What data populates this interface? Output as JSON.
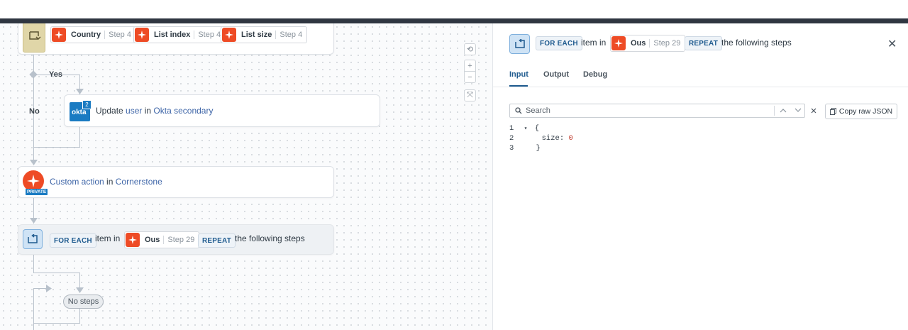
{
  "canvas": {
    "top_card": {
      "pills": [
        {
          "name": "Country",
          "step": "Step 4"
        },
        {
          "name": "List index",
          "step": "Step 4"
        },
        {
          "name": "List size",
          "step": "Step 4"
        }
      ]
    },
    "branch": {
      "yes_label": "Yes",
      "no_label": "No"
    },
    "update_step": {
      "badge_count": "2",
      "badge_text": "okta",
      "verb": "Update",
      "object": "user",
      "in": "in",
      "app": "Okta secondary"
    },
    "custom_step": {
      "verb": "Custom action",
      "in": "in",
      "app": "Cornerstone",
      "tag": "PRIVATE"
    },
    "foreach_step": {
      "keyword": "FOR EACH",
      "item_in": "item in",
      "pill_name": "Ous",
      "pill_step": "Step 29",
      "repeat": "REPEAT",
      "tail": "the following steps"
    },
    "no_steps_label": "No steps",
    "zoom": {
      "reset": "⟲",
      "in": "+",
      "out": "−",
      "fit": "⤧"
    }
  },
  "panel": {
    "header": {
      "keyword": "FOR EACH",
      "item_in": "item in",
      "pill_name": "Ous",
      "pill_step": "Step 29",
      "repeat": "REPEAT",
      "tail": "the following steps",
      "close": "✕"
    },
    "tabs": [
      {
        "label": "Input",
        "active": true
      },
      {
        "label": "Output",
        "active": false
      },
      {
        "label": "Debug",
        "active": false
      }
    ],
    "search": {
      "placeholder": "Search",
      "value": ""
    },
    "copy_label": "Copy raw JSON",
    "json_lines": [
      {
        "n": "1",
        "text": "{"
      },
      {
        "n": "2",
        "key": "size:",
        "value": "0"
      },
      {
        "n": "3",
        "text": "}"
      }
    ]
  },
  "colors": {
    "accent": "#1f5b8f",
    "brand_orange": "#ee4b25",
    "okta_blue": "#1a7bc2",
    "topbar": "#2f3641"
  }
}
